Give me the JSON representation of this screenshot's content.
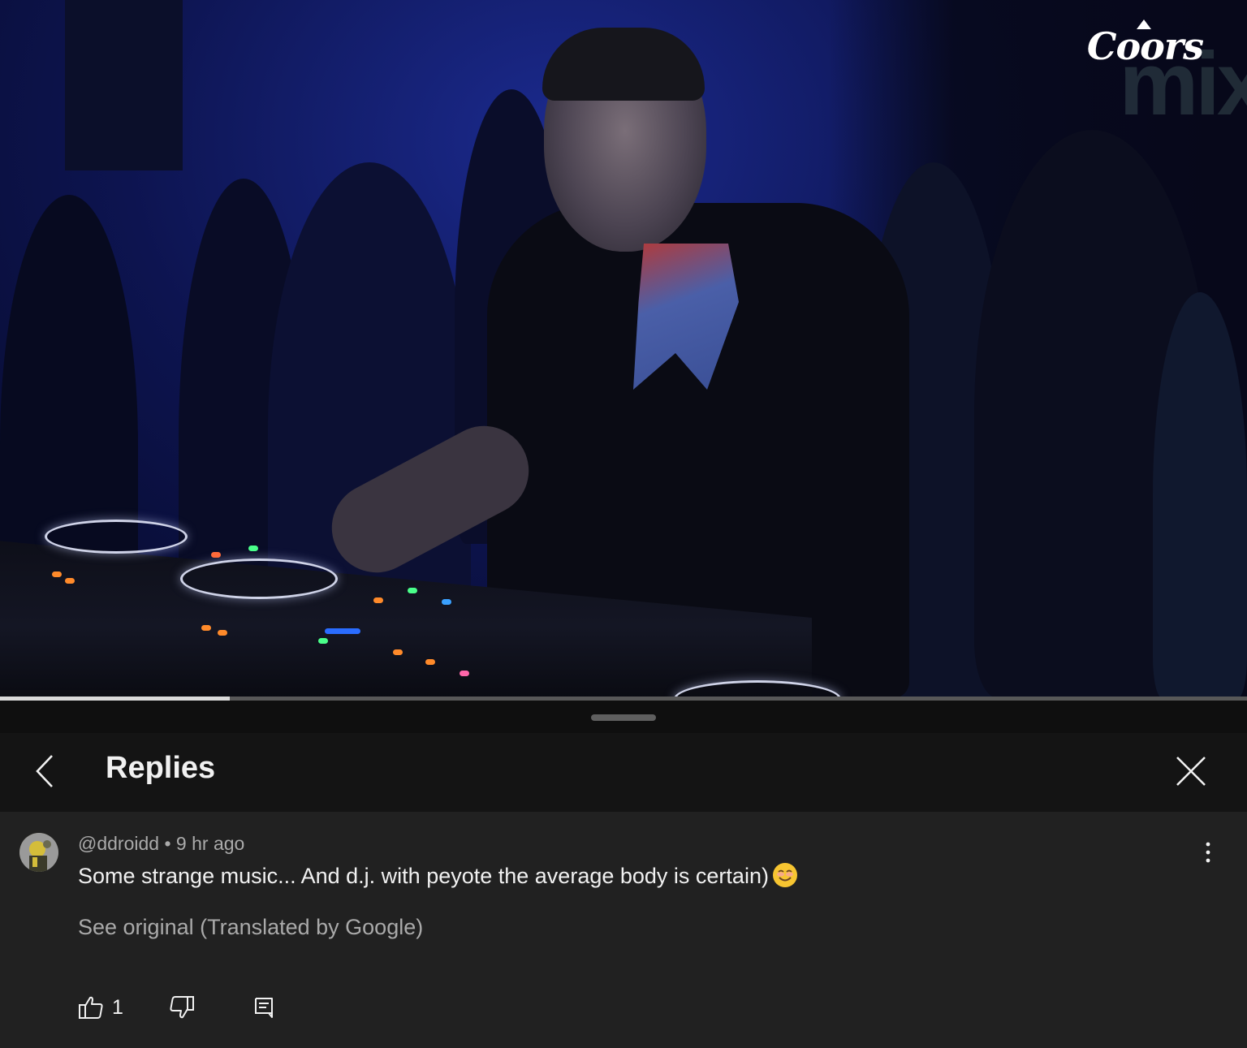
{
  "video": {
    "brand_text": "Coors",
    "watermark_text": "mix",
    "progress_fraction": 0.184
  },
  "sheet": {
    "title": "Replies",
    "back_icon": "chevron-left-icon",
    "close_icon": "close-icon"
  },
  "comment": {
    "author": "@ddroidd",
    "separator": "•",
    "time": "9 hr ago",
    "text": "Some strange music... And d.j. with peyote the average body is certain)",
    "emoji": "smiling-face-emoji",
    "see_original": "See original (Translated by Google)",
    "like_count": "1",
    "more_icon": "more-vert-icon"
  },
  "colors": {
    "background": "#0f0f0f",
    "header_bg": "#141414",
    "comment_bg": "#212121",
    "text_primary": "#f1f1f1",
    "text_secondary": "#aaaaaa"
  }
}
